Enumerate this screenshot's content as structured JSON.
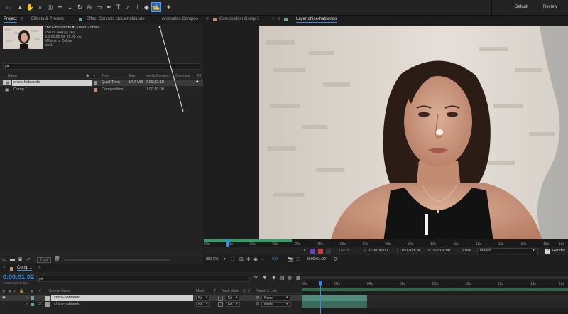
{
  "workspace": {
    "default_label": "Default",
    "review_label": "Review"
  },
  "project_panel": {
    "tabs": [
      "Project",
      "Effects & Presets",
      "Effect Controls chica-hablando",
      "Animation Compo"
    ],
    "info": {
      "name_line": "chica-hablando ▾ , used 2 times",
      "dims": "2560 x 1440 (1,00)",
      "duration": "Δ 0:00:22:18, 25,00 fps",
      "colors": "Millions of Colors",
      "codec": "avc1"
    },
    "search_placeholder": "ρ▾",
    "columns": {
      "name": "Name",
      "type": "Type",
      "size": "Size",
      "media_duration": "Media Duration",
      "comment": "Comment",
      "fi": "Fil"
    },
    "items": [
      {
        "name": "chica-hablando",
        "type": "QuickTime",
        "size": "14,7 MB",
        "duration": "0:00:22:18",
        "color": "#4aa6a0",
        "label": "#6e9fa0"
      },
      {
        "name": "Comp 1",
        "type": "Composition",
        "size": "",
        "duration": "0:00:30:00",
        "color": "#b29a7e",
        "label": "#c08e75"
      }
    ],
    "bpc": "8 bpc"
  },
  "viewer": {
    "tabs": [
      "Composition Comp 1",
      "Layer chica-hablando"
    ],
    "ruler_ticks": [
      "00s",
      "01s",
      "02s",
      "03s",
      "04s",
      "05s",
      "06s",
      "07s",
      "08s",
      "09s",
      "10s",
      "11s",
      "12s",
      "13s",
      "14s",
      "15s",
      "16s"
    ],
    "controls": {
      "zoom_pct": "100 %",
      "in_time": "0:00:00:00",
      "out_time": "0:00:03:24",
      "duration": "Δ 0:00:04:00",
      "view_label": "View:",
      "view_value": "Masks",
      "render_label": "Render"
    },
    "bottom": {
      "magnification": "(82,1%)",
      "exposure": "+0,0",
      "timecode": "0:00:01:02"
    }
  },
  "timeline": {
    "comp_tab": "Comp 1",
    "timecode": "0:00:01:02",
    "frames": "00027 (25.00 fps)",
    "search_placeholder": "ρ▾",
    "columns": {
      "num": "#",
      "source": "Source Name",
      "mode": "Mode",
      "t": "T",
      "trkmat": "Track Matte",
      "parent": "Parent & Link"
    },
    "layers": [
      {
        "num": "1",
        "name": "chica-hablando",
        "mode": "No",
        "trkmat": "No",
        "parent": "None",
        "color": "#6e9fa0"
      },
      {
        "num": "2",
        "name": "chica-hablando",
        "mode": "No",
        "trkmat": "No",
        "parent": "None",
        "color": "#6e9fa0"
      }
    ],
    "ruler_ticks": [
      "00s",
      "02s",
      "04s",
      "06s",
      "08s",
      "10s",
      "12s",
      "14s",
      "16s"
    ]
  },
  "colors": {
    "accent": "#2d8ceb",
    "work_area": "#2f9f63"
  }
}
